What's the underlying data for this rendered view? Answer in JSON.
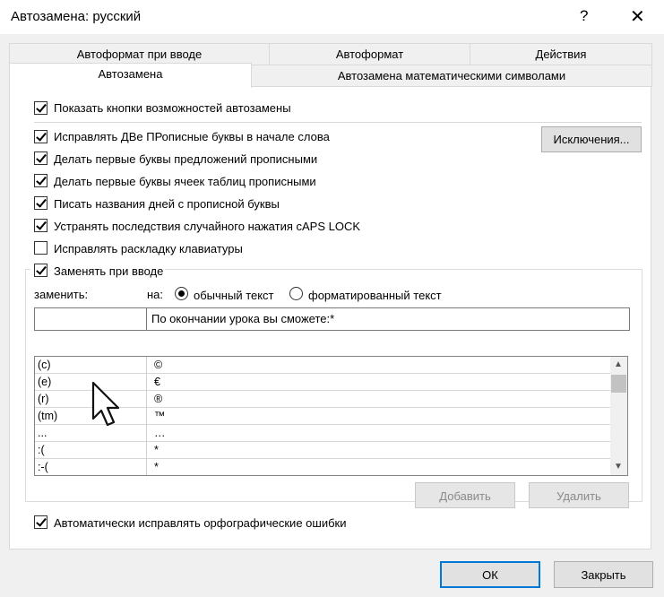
{
  "window": {
    "title": "Автозамена: русский",
    "help_glyph": "?",
    "close_glyph": "✕"
  },
  "tabs": {
    "row1": [
      "Автоформат при вводе",
      "Автоформат",
      "Действия"
    ],
    "row2": [
      "Автозамена",
      "Автозамена математическими символами"
    ]
  },
  "options": {
    "show_buttons": "Показать кнопки возможностей автозамены",
    "two_caps": "Исправлять ДВе ПРописные буквы в начале слова",
    "sentence_caps": "Делать первые буквы предложений прописными",
    "cell_caps": "Делать первые буквы ячеек таблиц прописными",
    "day_names": "Писать названия дней с прописной буквы",
    "caps_lock": "Устранять последствия случайного нажатия cAPS LOCK",
    "keyboard_layout": "Исправлять раскладку клавиатуры",
    "replace_as_type": "Заменять при вводе",
    "auto_spell": "Автоматически исправлять орфографические ошибки"
  },
  "exceptions_button": "Исключения...",
  "replace": {
    "replace_label": "заменить:",
    "with_label": "на:",
    "plain_text": "обычный текст",
    "formatted_text": "форматированный текст",
    "replace_value": "",
    "with_value": "По окончании урока вы сможете:*"
  },
  "entries": [
    {
      "from": "(c)",
      "to": "©"
    },
    {
      "from": "(e)",
      "to": "€"
    },
    {
      "from": "(r)",
      "to": "®"
    },
    {
      "from": "(tm)",
      "to": "™"
    },
    {
      "from": "...",
      "to": "…"
    },
    {
      "from": ":(",
      "to": "*"
    },
    {
      "from": ":-(",
      "to": "*"
    }
  ],
  "buttons": {
    "add": "Добавить",
    "delete": "Удалить",
    "ok": "ОК",
    "close": "Закрыть"
  }
}
